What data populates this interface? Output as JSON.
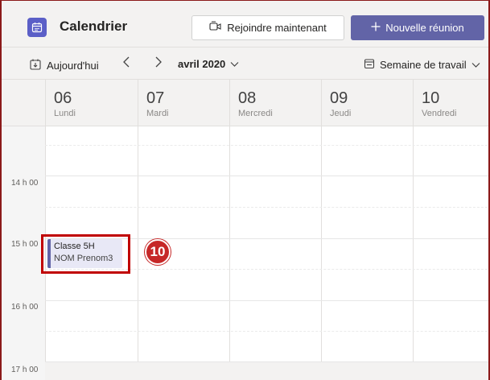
{
  "header": {
    "title": "Calendrier",
    "join_label": "Rejoindre maintenant",
    "new_meeting_label": "Nouvelle réunion"
  },
  "toolbar": {
    "today_label": "Aujourd'hui",
    "month_label": "avril 2020",
    "view_label": "Semaine de travail"
  },
  "days": [
    {
      "num": "06",
      "name": "Lundi"
    },
    {
      "num": "07",
      "name": "Mardi"
    },
    {
      "num": "08",
      "name": "Mercredi"
    },
    {
      "num": "09",
      "name": "Jeudi"
    },
    {
      "num": "10",
      "name": "Vendredi"
    }
  ],
  "times": [
    "14 h 00",
    "15 h 00",
    "16 h 00",
    "17 h 00"
  ],
  "event": {
    "title": "Classe 5H",
    "subtitle": "NOM Prenom3"
  },
  "annotation": {
    "badge": "10"
  },
  "colors": {
    "accent": "#6264a7",
    "highlight": "#c00000"
  }
}
